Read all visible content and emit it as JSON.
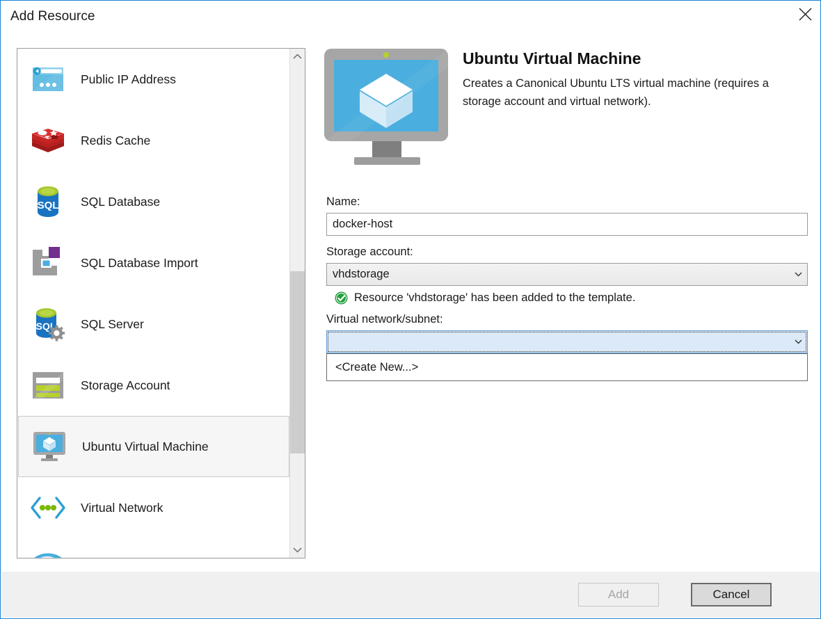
{
  "window": {
    "title": "Add Resource",
    "close_icon": "close-icon",
    "accent_color": "#1b84d8"
  },
  "resource_list": {
    "scrollbar": {
      "up_icon": "chevron-up-icon",
      "down_icon": "chevron-down-icon"
    },
    "items": [
      {
        "label": "Public IP Address",
        "icon": "public-ip-address-icon",
        "selected": false
      },
      {
        "label": "Redis Cache",
        "icon": "redis-cache-icon",
        "selected": false
      },
      {
        "label": "SQL Database",
        "icon": "sql-database-icon",
        "selected": false
      },
      {
        "label": "SQL Database Import",
        "icon": "sql-database-import-icon",
        "selected": false
      },
      {
        "label": "SQL Server",
        "icon": "sql-server-icon",
        "selected": false
      },
      {
        "label": "Storage Account",
        "icon": "storage-account-icon",
        "selected": false
      },
      {
        "label": "Ubuntu Virtual Machine",
        "icon": "ubuntu-virtual-machine-icon",
        "selected": true
      },
      {
        "label": "Virtual Network",
        "icon": "virtual-network-icon",
        "selected": false
      }
    ]
  },
  "detail": {
    "icon": "ubuntu-virtual-machine-icon",
    "title": "Ubuntu Virtual Machine",
    "description": "Creates a Canonical Ubuntu LTS virtual machine (requires a storage account and virtual network).",
    "name_field": {
      "label": "Name:",
      "value": "docker-host",
      "placeholder": ""
    },
    "storage_account_field": {
      "label": "Storage account:",
      "value": "vhdstorage",
      "arrow_icon": "chevron-down-icon"
    },
    "status": {
      "icon": "success-check-icon",
      "color": "#22A03C",
      "text": "Resource 'vhdstorage' has been added to the template."
    },
    "vnet_field": {
      "label": "Virtual network/subnet:",
      "value": "",
      "arrow_icon": "chevron-down-icon",
      "options": [
        "<Create New...>"
      ]
    }
  },
  "footer": {
    "add_label": "Add",
    "cancel_label": "Cancel"
  }
}
